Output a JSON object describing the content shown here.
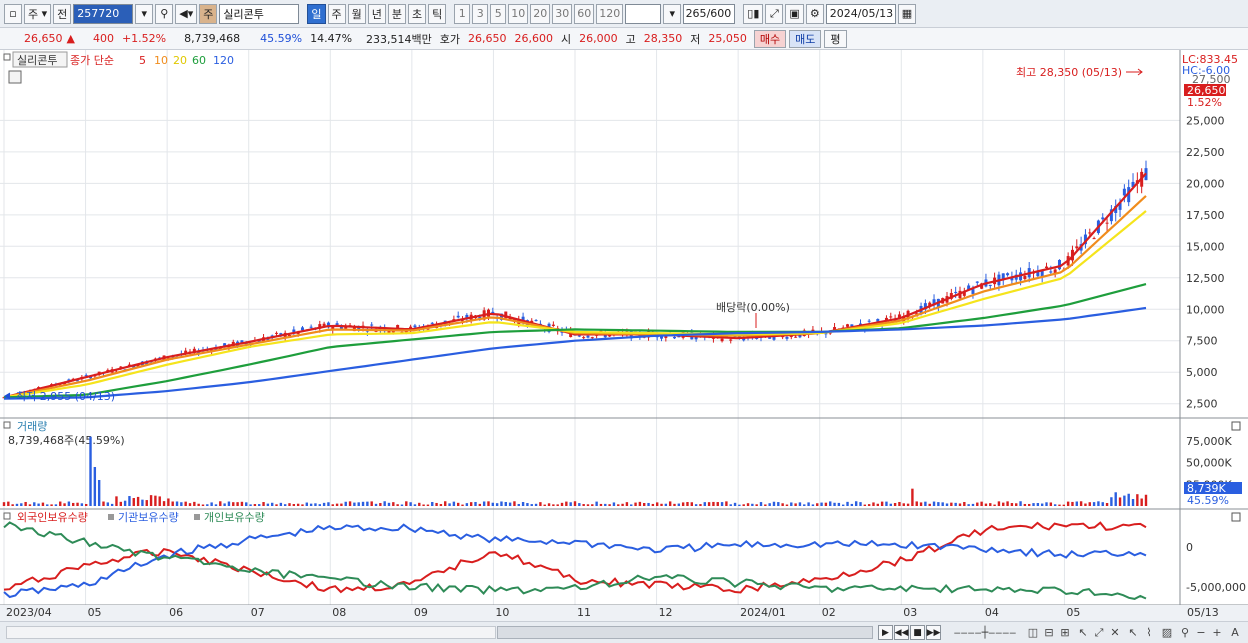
{
  "toolbar": {
    "market_label": "주",
    "prev_label": "전",
    "code": "257720",
    "stock_type": "주",
    "stock_name": "실리콘투",
    "periods": [
      "일",
      "주",
      "월",
      "년",
      "분",
      "초",
      "틱"
    ],
    "active_period": "일",
    "numbers": [
      "1",
      "3",
      "5",
      "10",
      "20",
      "30",
      "60",
      "120"
    ],
    "count": "265",
    "count_total": "/600",
    "date": "2024/05/13"
  },
  "quote": {
    "price": "26,650",
    "arrow": "▲",
    "change": "400",
    "change_pct": "+1.52%",
    "volume": "8,739,468",
    "vol_ratio": "45.59%",
    "turnover": "14.47%",
    "amount": "233,514백만",
    "bid_label": "호가",
    "ask": "26,650",
    "bid": "26,600",
    "open_label": "시",
    "open": "26,000",
    "high_label": "고",
    "high": "28,350",
    "low_label": "저",
    "low": "25,050",
    "buy_label": "매수",
    "sell_label": "매도",
    "avg_label": "평"
  },
  "price_panel": {
    "name_tag": "실리콘투",
    "ma_label": "종가 단순",
    "ma_periods": [
      "5",
      "10",
      "20",
      "60",
      "120"
    ],
    "ma_colors": [
      "#d81e1e",
      "#f08c1c",
      "#f5e41c",
      "#1e9e3c",
      "#2a5ee0"
    ],
    "max_annotation": "최고 28,350 (05/13)",
    "min_annotation": "최저 2,955 (04/13)",
    "dividend_annotation": "배당락(0.00%)",
    "lc": "LC:833.45",
    "hc": "HC:-6.00",
    "right_top": "27,500",
    "price_badge": "26,650",
    "pct_badge": "1.52%",
    "y_ticks": [
      "25,000",
      "22,500",
      "20,000",
      "17,500",
      "15,000",
      "12,500",
      "10,000",
      "7,500",
      "5,000",
      "2,500"
    ]
  },
  "volume_panel": {
    "title": "거래량",
    "value": "8,739,468주(45.59%)",
    "y_ticks": [
      "75,000K",
      "50,000K",
      "25,000K"
    ],
    "badge": "8,739K",
    "badge_pct": "45.59%"
  },
  "holdings_panel": {
    "legend": [
      "외국인보유수량",
      "기관보유수량",
      "개인보유수량"
    ],
    "legend_colors": [
      "#d81e1e",
      "#2a5ee0",
      "#2e8b57"
    ],
    "y_ticks": [
      "0",
      "-5,000,000"
    ]
  },
  "x_axis": {
    "labels": [
      "2023/04",
      "05",
      "06",
      "07",
      "08",
      "09",
      "10",
      "11",
      "12",
      "2024/01",
      "02",
      "03",
      "04",
      "05"
    ],
    "right_label": "05/13"
  },
  "chart_data": {
    "type": "line",
    "title": "실리콘투",
    "x": [
      "2023/04",
      "05",
      "06",
      "07",
      "08",
      "09",
      "10",
      "11",
      "12",
      "2024/01",
      "02",
      "03",
      "04",
      "05",
      "05/13"
    ],
    "series": [
      {
        "name": "5",
        "values": [
          3000,
          4600,
          6200,
          7400,
          8700,
          8400,
          9700,
          8000,
          8000,
          7700,
          8100,
          9300,
          12000,
          13500,
          20800
        ]
      },
      {
        "name": "10",
        "values": [
          3000,
          4300,
          6000,
          7200,
          8400,
          8300,
          9400,
          8100,
          8000,
          7900,
          8100,
          9100,
          11400,
          13000,
          19000
        ]
      },
      {
        "name": "20",
        "values": [
          3000,
          4000,
          5600,
          7000,
          8000,
          8100,
          9000,
          8200,
          8100,
          8000,
          8100,
          8900,
          10800,
          12500,
          17800
        ]
      },
      {
        "name": "60",
        "values": [
          3000,
          3200,
          4300,
          5600,
          7000,
          7600,
          8200,
          8400,
          8300,
          8200,
          8200,
          8500,
          9300,
          10300,
          12000
        ]
      },
      {
        "name": "120",
        "values": [
          2900,
          3000,
          3500,
          4200,
          5100,
          6000,
          6900,
          7500,
          7900,
          8100,
          8200,
          8400,
          8700,
          9200,
          10100
        ]
      }
    ],
    "ylim": [
      2000,
      29000
    ]
  }
}
